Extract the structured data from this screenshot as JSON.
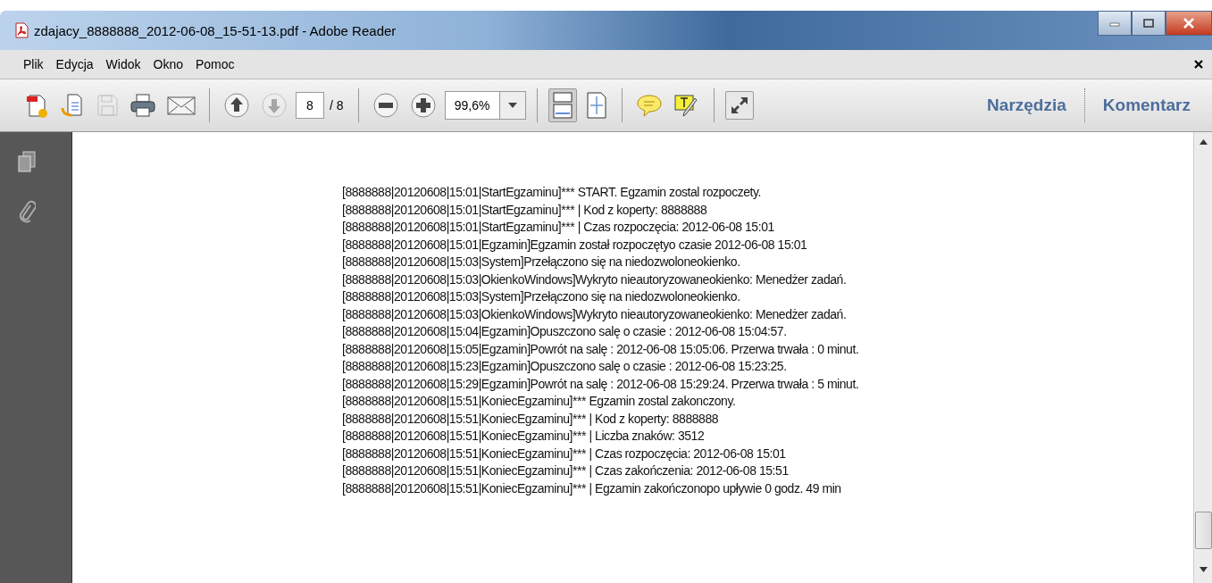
{
  "window": {
    "title": "zdajacy_8888888_2012-06-08_15-51-13.pdf - Adobe Reader"
  },
  "menu": [
    "Plik",
    "Edycja",
    "Widok",
    "Okno",
    "Pomoc"
  ],
  "toolbar": {
    "save_disabled": true,
    "next_page_disabled": true,
    "fit_width_selected": true,
    "page_field": "8",
    "page_count": "/ 8",
    "zoom": "99,6%",
    "panes": [
      "Narzędzia",
      "Komentarz"
    ]
  },
  "document": {
    "lines": [
      "[8888888|20120608|15:01|StartEgzaminu]*** START. Egzamin zostal rozpoczety.",
      "[8888888|20120608|15:01|StartEgzaminu]*** | Kod z koperty: 8888888",
      "[8888888|20120608|15:01|StartEgzaminu]*** | Czas rozpoczęcia: 2012-06-08 15:01",
      "[8888888|20120608|15:01|Egzamin]Egzamin został rozpoczętyo czasie 2012-06-08 15:01",
      "[8888888|20120608|15:03|System]Przełączono się na niedozwoloneokienko.",
      "[8888888|20120608|15:03|OkienkoWindows]Wykryto nieautoryzowaneokienko: Menedżer zadań.",
      "[8888888|20120608|15:03|System]Przełączono się na niedozwoloneokienko.",
      "[8888888|20120608|15:03|OkienkoWindows]Wykryto nieautoryzowaneokienko: Menedżer zadań.",
      "[8888888|20120608|15:04|Egzamin]Opuszczono salę o czasie : 2012-06-08 15:04:57.",
      "[8888888|20120608|15:05|Egzamin]Powrót na salę : 2012-06-08 15:05:06. Przerwa trwała : 0 minut.",
      "[8888888|20120608|15:23|Egzamin]Opuszczono salę o czasie : 2012-06-08 15:23:25.",
      "[8888888|20120608|15:29|Egzamin]Powrót na salę : 2012-06-08 15:29:24. Przerwa trwała : 5 minut.",
      "[8888888|20120608|15:51|KoniecEgzaminu]*** Egzamin zostal zakonczony.",
      "[8888888|20120608|15:51|KoniecEgzaminu]*** | Kod z koperty: 8888888",
      "[8888888|20120608|15:51|KoniecEgzaminu]*** | Liczba znaków: 3512",
      "[8888888|20120608|15:51|KoniecEgzaminu]*** | Czas rozpoczęcia: 2012-06-08 15:01",
      "[8888888|20120608|15:51|KoniecEgzaminu]*** | Czas zakończenia: 2012-06-08 15:51",
      "[8888888|20120608|15:51|KoniecEgzaminu]*** | Egzamin zakończonopo upływie 0 godz. 49 min"
    ]
  }
}
